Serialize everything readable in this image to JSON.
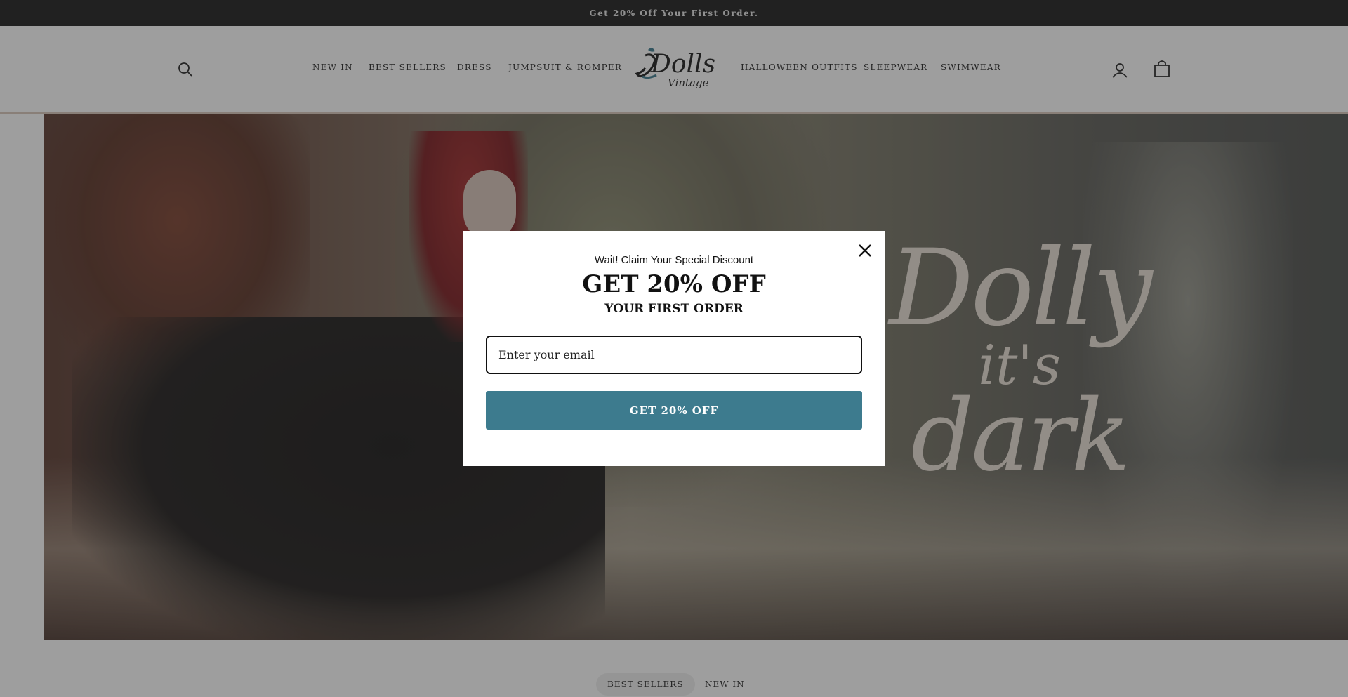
{
  "announcement": {
    "text": "Get 20% Off Your First Order."
  },
  "header": {
    "nav_left": [
      {
        "label": "NEW IN"
      },
      {
        "label": "BEST SELLERS"
      },
      {
        "label": "DRESS"
      },
      {
        "label": "JUMPSUIT & ROMPER"
      }
    ],
    "nav_right": [
      {
        "label": "HALLOWEEN OUTFITS"
      },
      {
        "label": "SLEEPWEAR"
      },
      {
        "label": "SWIMWEAR"
      }
    ],
    "logo": {
      "text_main": "Dolls",
      "text_sub": "Vintage"
    },
    "icons": {
      "search": "search-icon",
      "account": "user-icon",
      "cart": "shopping-bag-icon"
    }
  },
  "hero": {
    "title_line1": "Dolly",
    "title_line2": "it's",
    "title_line3": "dark"
  },
  "collection_tabs": [
    {
      "label": "BEST SELLERS",
      "active": true
    },
    {
      "label": "NEW IN",
      "active": false
    }
  ],
  "modal": {
    "kicker": "Wait! Claim Your Special Discount",
    "title": "GET 20% OFF",
    "subtitle": "YOUR FIRST ORDER",
    "email_placeholder": "Enter your email",
    "email_value": "",
    "submit_label": "GET 20% OFF",
    "close_icon": "close-icon"
  },
  "colors": {
    "announcement_bg": "#1c1c1c",
    "button_accent": "#3d7b8e",
    "overlay": "#282828"
  }
}
